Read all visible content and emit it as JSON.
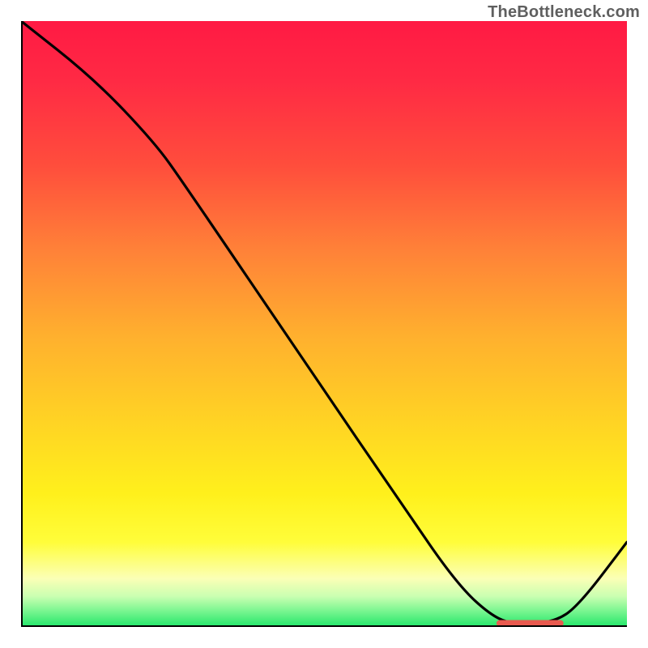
{
  "watermark": "TheBottleneck.com",
  "chart_data": {
    "type": "line",
    "title": "",
    "xlabel": "",
    "ylabel": "",
    "xlim": [
      0,
      100
    ],
    "ylim": [
      0,
      100
    ],
    "series": [
      {
        "name": "curve",
        "points": [
          {
            "x": 0,
            "y": 100
          },
          {
            "x": 12,
            "y": 90.5
          },
          {
            "x": 22,
            "y": 80
          },
          {
            "x": 27,
            "y": 73
          },
          {
            "x": 48,
            "y": 42
          },
          {
            "x": 63,
            "y": 20
          },
          {
            "x": 72,
            "y": 7
          },
          {
            "x": 78,
            "y": 1.5
          },
          {
            "x": 82,
            "y": 0.4
          },
          {
            "x": 88,
            "y": 0.8
          },
          {
            "x": 92,
            "y": 3.5
          },
          {
            "x": 100,
            "y": 14
          }
        ]
      }
    ],
    "marker": {
      "x_start": 79,
      "x_end": 89,
      "y": 0.6
    },
    "grid": false,
    "legend": false
  },
  "colors": {
    "gradient_top": "#ff1a44",
    "gradient_mid": "#ffd324",
    "gradient_bottom": "#22e66a",
    "curve": "#000000",
    "marker": "#e85a4f",
    "watermark": "#5f5f5f"
  }
}
